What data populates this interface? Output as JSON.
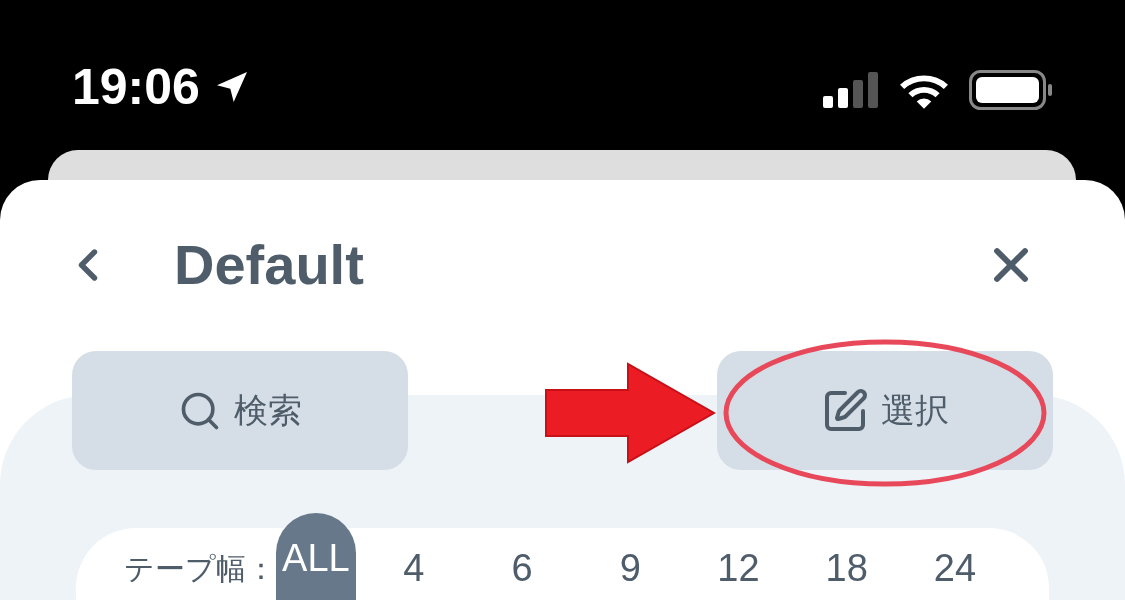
{
  "status_bar": {
    "time": "19:06"
  },
  "header": {
    "title": "Default"
  },
  "actions": [
    {
      "kind": "search",
      "label": "検索"
    },
    {
      "kind": "select",
      "label": "選択"
    }
  ],
  "tape_width": {
    "label": "テープ幅：",
    "options": [
      {
        "label": "ALL",
        "selected": true
      },
      {
        "label": "4",
        "selected": false
      },
      {
        "label": "6",
        "selected": false
      },
      {
        "label": "9",
        "selected": false
      },
      {
        "label": "12",
        "selected": false
      },
      {
        "label": "18",
        "selected": false
      },
      {
        "label": "24",
        "selected": false
      }
    ]
  }
}
